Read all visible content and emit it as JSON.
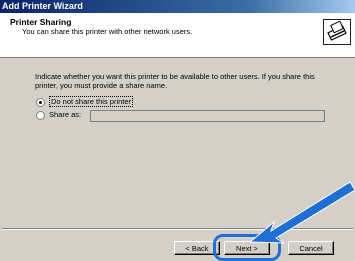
{
  "window": {
    "title": "Add Printer Wizard"
  },
  "header": {
    "title": "Printer Sharing",
    "subtitle": "You can share this printer with other network users."
  },
  "main": {
    "description": "Indicate whether you want this printer to be available to other users. If you share this printer, you must provide a share name.",
    "options": [
      {
        "label": "Do not share this printer",
        "selected": true
      },
      {
        "label": "Share as:",
        "selected": false
      }
    ],
    "share_name_value": ""
  },
  "buttons": {
    "back": "< Back",
    "next": "Next >",
    "cancel": "Cancel"
  },
  "colors": {
    "highlight": "#1e6fd6",
    "titlebar": "#0a246a"
  }
}
